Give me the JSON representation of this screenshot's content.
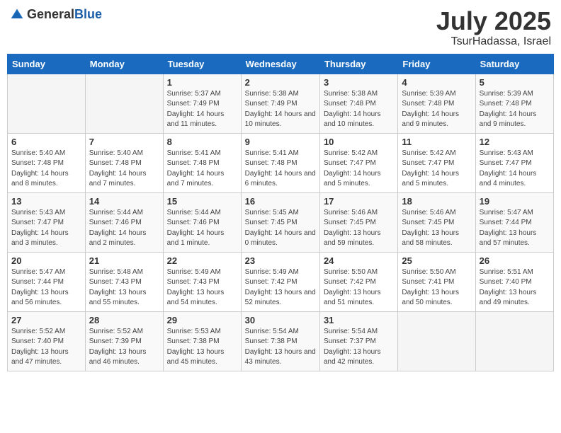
{
  "header": {
    "logo_general": "General",
    "logo_blue": "Blue",
    "month": "July 2025",
    "location": "TsurHadassa, Israel"
  },
  "weekdays": [
    "Sunday",
    "Monday",
    "Tuesday",
    "Wednesday",
    "Thursday",
    "Friday",
    "Saturday"
  ],
  "weeks": [
    [
      {
        "day": "",
        "info": ""
      },
      {
        "day": "",
        "info": ""
      },
      {
        "day": "1",
        "info": "Sunrise: 5:37 AM\nSunset: 7:49 PM\nDaylight: 14 hours and 11 minutes."
      },
      {
        "day": "2",
        "info": "Sunrise: 5:38 AM\nSunset: 7:49 PM\nDaylight: 14 hours and 10 minutes."
      },
      {
        "day": "3",
        "info": "Sunrise: 5:38 AM\nSunset: 7:48 PM\nDaylight: 14 hours and 10 minutes."
      },
      {
        "day": "4",
        "info": "Sunrise: 5:39 AM\nSunset: 7:48 PM\nDaylight: 14 hours and 9 minutes."
      },
      {
        "day": "5",
        "info": "Sunrise: 5:39 AM\nSunset: 7:48 PM\nDaylight: 14 hours and 9 minutes."
      }
    ],
    [
      {
        "day": "6",
        "info": "Sunrise: 5:40 AM\nSunset: 7:48 PM\nDaylight: 14 hours and 8 minutes."
      },
      {
        "day": "7",
        "info": "Sunrise: 5:40 AM\nSunset: 7:48 PM\nDaylight: 14 hours and 7 minutes."
      },
      {
        "day": "8",
        "info": "Sunrise: 5:41 AM\nSunset: 7:48 PM\nDaylight: 14 hours and 7 minutes."
      },
      {
        "day": "9",
        "info": "Sunrise: 5:41 AM\nSunset: 7:48 PM\nDaylight: 14 hours and 6 minutes."
      },
      {
        "day": "10",
        "info": "Sunrise: 5:42 AM\nSunset: 7:47 PM\nDaylight: 14 hours and 5 minutes."
      },
      {
        "day": "11",
        "info": "Sunrise: 5:42 AM\nSunset: 7:47 PM\nDaylight: 14 hours and 5 minutes."
      },
      {
        "day": "12",
        "info": "Sunrise: 5:43 AM\nSunset: 7:47 PM\nDaylight: 14 hours and 4 minutes."
      }
    ],
    [
      {
        "day": "13",
        "info": "Sunrise: 5:43 AM\nSunset: 7:47 PM\nDaylight: 14 hours and 3 minutes."
      },
      {
        "day": "14",
        "info": "Sunrise: 5:44 AM\nSunset: 7:46 PM\nDaylight: 14 hours and 2 minutes."
      },
      {
        "day": "15",
        "info": "Sunrise: 5:44 AM\nSunset: 7:46 PM\nDaylight: 14 hours and 1 minute."
      },
      {
        "day": "16",
        "info": "Sunrise: 5:45 AM\nSunset: 7:45 PM\nDaylight: 14 hours and 0 minutes."
      },
      {
        "day": "17",
        "info": "Sunrise: 5:46 AM\nSunset: 7:45 PM\nDaylight: 13 hours and 59 minutes."
      },
      {
        "day": "18",
        "info": "Sunrise: 5:46 AM\nSunset: 7:45 PM\nDaylight: 13 hours and 58 minutes."
      },
      {
        "day": "19",
        "info": "Sunrise: 5:47 AM\nSunset: 7:44 PM\nDaylight: 13 hours and 57 minutes."
      }
    ],
    [
      {
        "day": "20",
        "info": "Sunrise: 5:47 AM\nSunset: 7:44 PM\nDaylight: 13 hours and 56 minutes."
      },
      {
        "day": "21",
        "info": "Sunrise: 5:48 AM\nSunset: 7:43 PM\nDaylight: 13 hours and 55 minutes."
      },
      {
        "day": "22",
        "info": "Sunrise: 5:49 AM\nSunset: 7:43 PM\nDaylight: 13 hours and 54 minutes."
      },
      {
        "day": "23",
        "info": "Sunrise: 5:49 AM\nSunset: 7:42 PM\nDaylight: 13 hours and 52 minutes."
      },
      {
        "day": "24",
        "info": "Sunrise: 5:50 AM\nSunset: 7:42 PM\nDaylight: 13 hours and 51 minutes."
      },
      {
        "day": "25",
        "info": "Sunrise: 5:50 AM\nSunset: 7:41 PM\nDaylight: 13 hours and 50 minutes."
      },
      {
        "day": "26",
        "info": "Sunrise: 5:51 AM\nSunset: 7:40 PM\nDaylight: 13 hours and 49 minutes."
      }
    ],
    [
      {
        "day": "27",
        "info": "Sunrise: 5:52 AM\nSunset: 7:40 PM\nDaylight: 13 hours and 47 minutes."
      },
      {
        "day": "28",
        "info": "Sunrise: 5:52 AM\nSunset: 7:39 PM\nDaylight: 13 hours and 46 minutes."
      },
      {
        "day": "29",
        "info": "Sunrise: 5:53 AM\nSunset: 7:38 PM\nDaylight: 13 hours and 45 minutes."
      },
      {
        "day": "30",
        "info": "Sunrise: 5:54 AM\nSunset: 7:38 PM\nDaylight: 13 hours and 43 minutes."
      },
      {
        "day": "31",
        "info": "Sunrise: 5:54 AM\nSunset: 7:37 PM\nDaylight: 13 hours and 42 minutes."
      },
      {
        "day": "",
        "info": ""
      },
      {
        "day": "",
        "info": ""
      }
    ]
  ]
}
